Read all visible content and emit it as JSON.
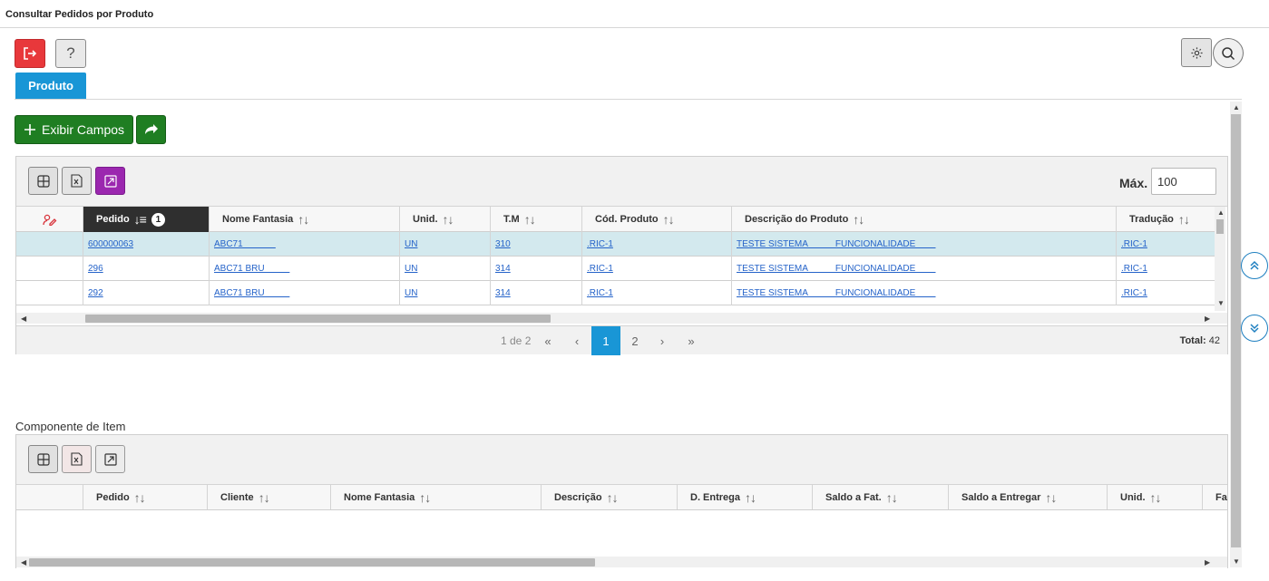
{
  "window": {
    "title": "Consultar Pedidos por Produto"
  },
  "toolbar": {
    "help_label": "?"
  },
  "tabs": [
    {
      "label": "Produto"
    }
  ],
  "actions": {
    "exibir_campos_label": "Exibir Campos"
  },
  "main_grid": {
    "max_label": "Máx.",
    "max_value": "100",
    "sort_badge": "1",
    "columns": [
      {
        "label": ""
      },
      {
        "label": "Pedido"
      },
      {
        "label": "Nome Fantasia"
      },
      {
        "label": "Unid."
      },
      {
        "label": "T.M"
      },
      {
        "label": "Cód. Produto"
      },
      {
        "label": "Descrição do Produto"
      },
      {
        "label": "Tradução"
      }
    ],
    "rows": [
      {
        "pedido": "600000063",
        "nome": "ABC71             ",
        "unid": "UN",
        "tm": "310",
        "cod": ".RIC-1",
        "desc": "TESTE SISTEMA           FUNCIONALIDADE        ",
        "trad": ".RIC-1"
      },
      {
        "pedido": "296",
        "nome": "ABC71 BRU          ",
        "unid": "UN",
        "tm": "314",
        "cod": ".RIC-1",
        "desc": "TESTE SISTEMA           FUNCIONALIDADE        ",
        "trad": ".RIC-1"
      },
      {
        "pedido": "292",
        "nome": "ABC71 BRU          ",
        "unid": "UN",
        "tm": "314",
        "cod": ".RIC-1",
        "desc": "TESTE SISTEMA           FUNCIONALIDADE        ",
        "trad": ".RIC-1"
      }
    ],
    "pager": {
      "info": "1 de 2",
      "first": "«",
      "prev": "‹",
      "pages": [
        "1",
        "2"
      ],
      "next": "›",
      "last": "»",
      "total_label": "Total:",
      "total_value": "42"
    }
  },
  "component_grid": {
    "title": "Componente de Item",
    "columns": [
      {
        "label": ""
      },
      {
        "label": "Pedido"
      },
      {
        "label": "Cliente"
      },
      {
        "label": "Nome Fantasia"
      },
      {
        "label": "Descrição"
      },
      {
        "label": "D. Entrega"
      },
      {
        "label": "Saldo a Fat."
      },
      {
        "label": "Saldo a Entregar"
      },
      {
        "label": "Unid."
      },
      {
        "label": "Fat"
      }
    ]
  },
  "colors": {
    "primary": "#1996d6",
    "green": "#1f7e22",
    "red": "#e8383b",
    "purple": "#9b27af",
    "selected_row": "#d3e9ee"
  }
}
